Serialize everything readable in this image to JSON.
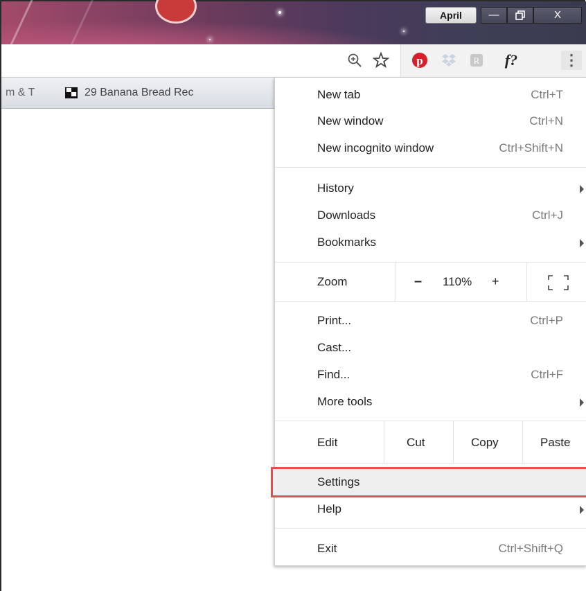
{
  "browser": {
    "profile_name": "April",
    "window_controls": {
      "minimize": "—",
      "restore": "🗗",
      "close": "X"
    },
    "toolbar_icons": [
      "zoom-icon",
      "bookmark-star-icon",
      "pinterest-icon",
      "dropbox-icon",
      "extension-icon",
      "font-finder-icon",
      "menu-icon"
    ],
    "font_finder_label": "f?",
    "menu_dots": "⋮"
  },
  "bookmarks_bar": {
    "items": [
      {
        "label": "m & T"
      },
      {
        "label": "29 Banana Bread Rec"
      }
    ]
  },
  "menu": {
    "new_tab": {
      "label": "New tab",
      "shortcut": "Ctrl+T"
    },
    "new_window": {
      "label": "New window",
      "shortcut": "Ctrl+N"
    },
    "new_incognito": {
      "label": "New incognito window",
      "shortcut": "Ctrl+Shift+N"
    },
    "history": {
      "label": "History"
    },
    "downloads": {
      "label": "Downloads",
      "shortcut": "Ctrl+J"
    },
    "bookmarks": {
      "label": "Bookmarks"
    },
    "zoom": {
      "label": "Zoom",
      "minus": "–",
      "value": "110%",
      "plus": "+"
    },
    "print": {
      "label": "Print...",
      "shortcut": "Ctrl+P"
    },
    "cast": {
      "label": "Cast..."
    },
    "find": {
      "label": "Find...",
      "shortcut": "Ctrl+F"
    },
    "more_tools": {
      "label": "More tools"
    },
    "edit": {
      "label": "Edit",
      "cut": "Cut",
      "copy": "Copy",
      "paste": "Paste"
    },
    "settings": {
      "label": "Settings"
    },
    "help": {
      "label": "Help"
    },
    "exit": {
      "label": "Exit",
      "shortcut": "Ctrl+Shift+Q"
    }
  },
  "colors": {
    "highlight_border": "#e34f4f",
    "pinterest": "#d6202c"
  }
}
